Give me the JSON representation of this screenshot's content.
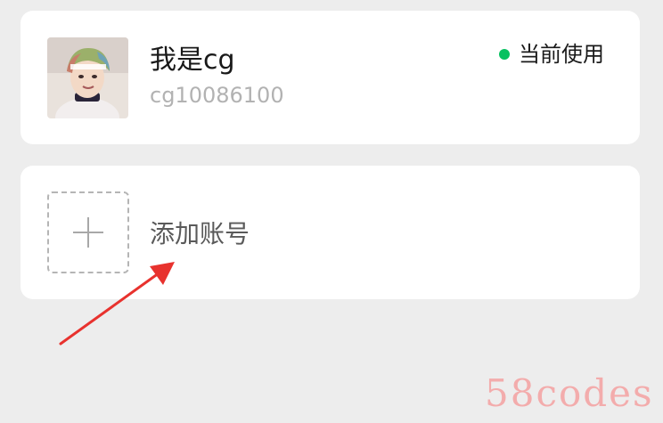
{
  "account": {
    "nickname": "我是cg",
    "wechat_id": "cg10086100",
    "status_text": "当前使用",
    "status_color": "#07c160"
  },
  "add_account": {
    "label": "添加账号",
    "icon": "plus-icon"
  },
  "annotation": {
    "arrow_color": "#e8322e"
  },
  "watermark": {
    "text": "58codes"
  }
}
